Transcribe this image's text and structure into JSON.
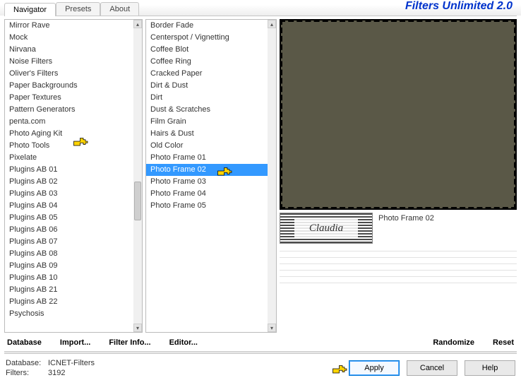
{
  "colors": {
    "accent": "#3399ff",
    "brand": "#0033cc"
  },
  "logo": "Filters Unlimited 2.0",
  "tabs": [
    {
      "label": "Navigator",
      "active": true
    },
    {
      "label": "Presets",
      "active": false
    },
    {
      "label": "About",
      "active": false
    }
  ],
  "leftList": [
    "Mirror Rave",
    "Mock",
    "Nirvana",
    "Noise Filters",
    "Oliver's Filters",
    "Paper Backgrounds",
    "Paper Textures",
    "Pattern Generators",
    "penta.com",
    "Photo Aging Kit",
    "Photo Tools",
    "Pixelate",
    "Plugins AB 01",
    "Plugins AB 02",
    "Plugins AB 03",
    "Plugins AB 04",
    "Plugins AB 05",
    "Plugins AB 06",
    "Plugins AB 07",
    "Plugins AB 08",
    "Plugins AB 09",
    "Plugins AB 10",
    "Plugins AB 21",
    "Plugins AB 22",
    "Psychosis"
  ],
  "leftScroll": {
    "thumbTopPct": 52,
    "thumbHeightPct": 13
  },
  "midList": {
    "items": [
      "Border Fade",
      "Centerspot / Vignetting",
      "Coffee Blot",
      "Coffee Ring",
      "Cracked Paper",
      "Dirt & Dust",
      "Dirt",
      "Dust & Scratches",
      "Film Grain",
      "Hairs & Dust",
      "Old Color",
      "Photo Frame 01",
      "Photo Frame 02",
      "Photo Frame 03",
      "Photo Frame 04",
      "Photo Frame 05"
    ],
    "selectedIndex": 12
  },
  "stampText": "Claudia",
  "presetName": "Photo Frame 02",
  "midButtons": {
    "database": "Database",
    "import": "Import...",
    "filterInfo": "Filter Info...",
    "editor": "Editor...",
    "randomize": "Randomize",
    "reset": "Reset"
  },
  "footer": {
    "databaseLabel": "Database:",
    "databaseValue": "ICNET-Filters",
    "filtersLabel": "Filters:",
    "filtersValue": "3192",
    "apply": "Apply",
    "cancel": "Cancel",
    "help": "Help"
  }
}
